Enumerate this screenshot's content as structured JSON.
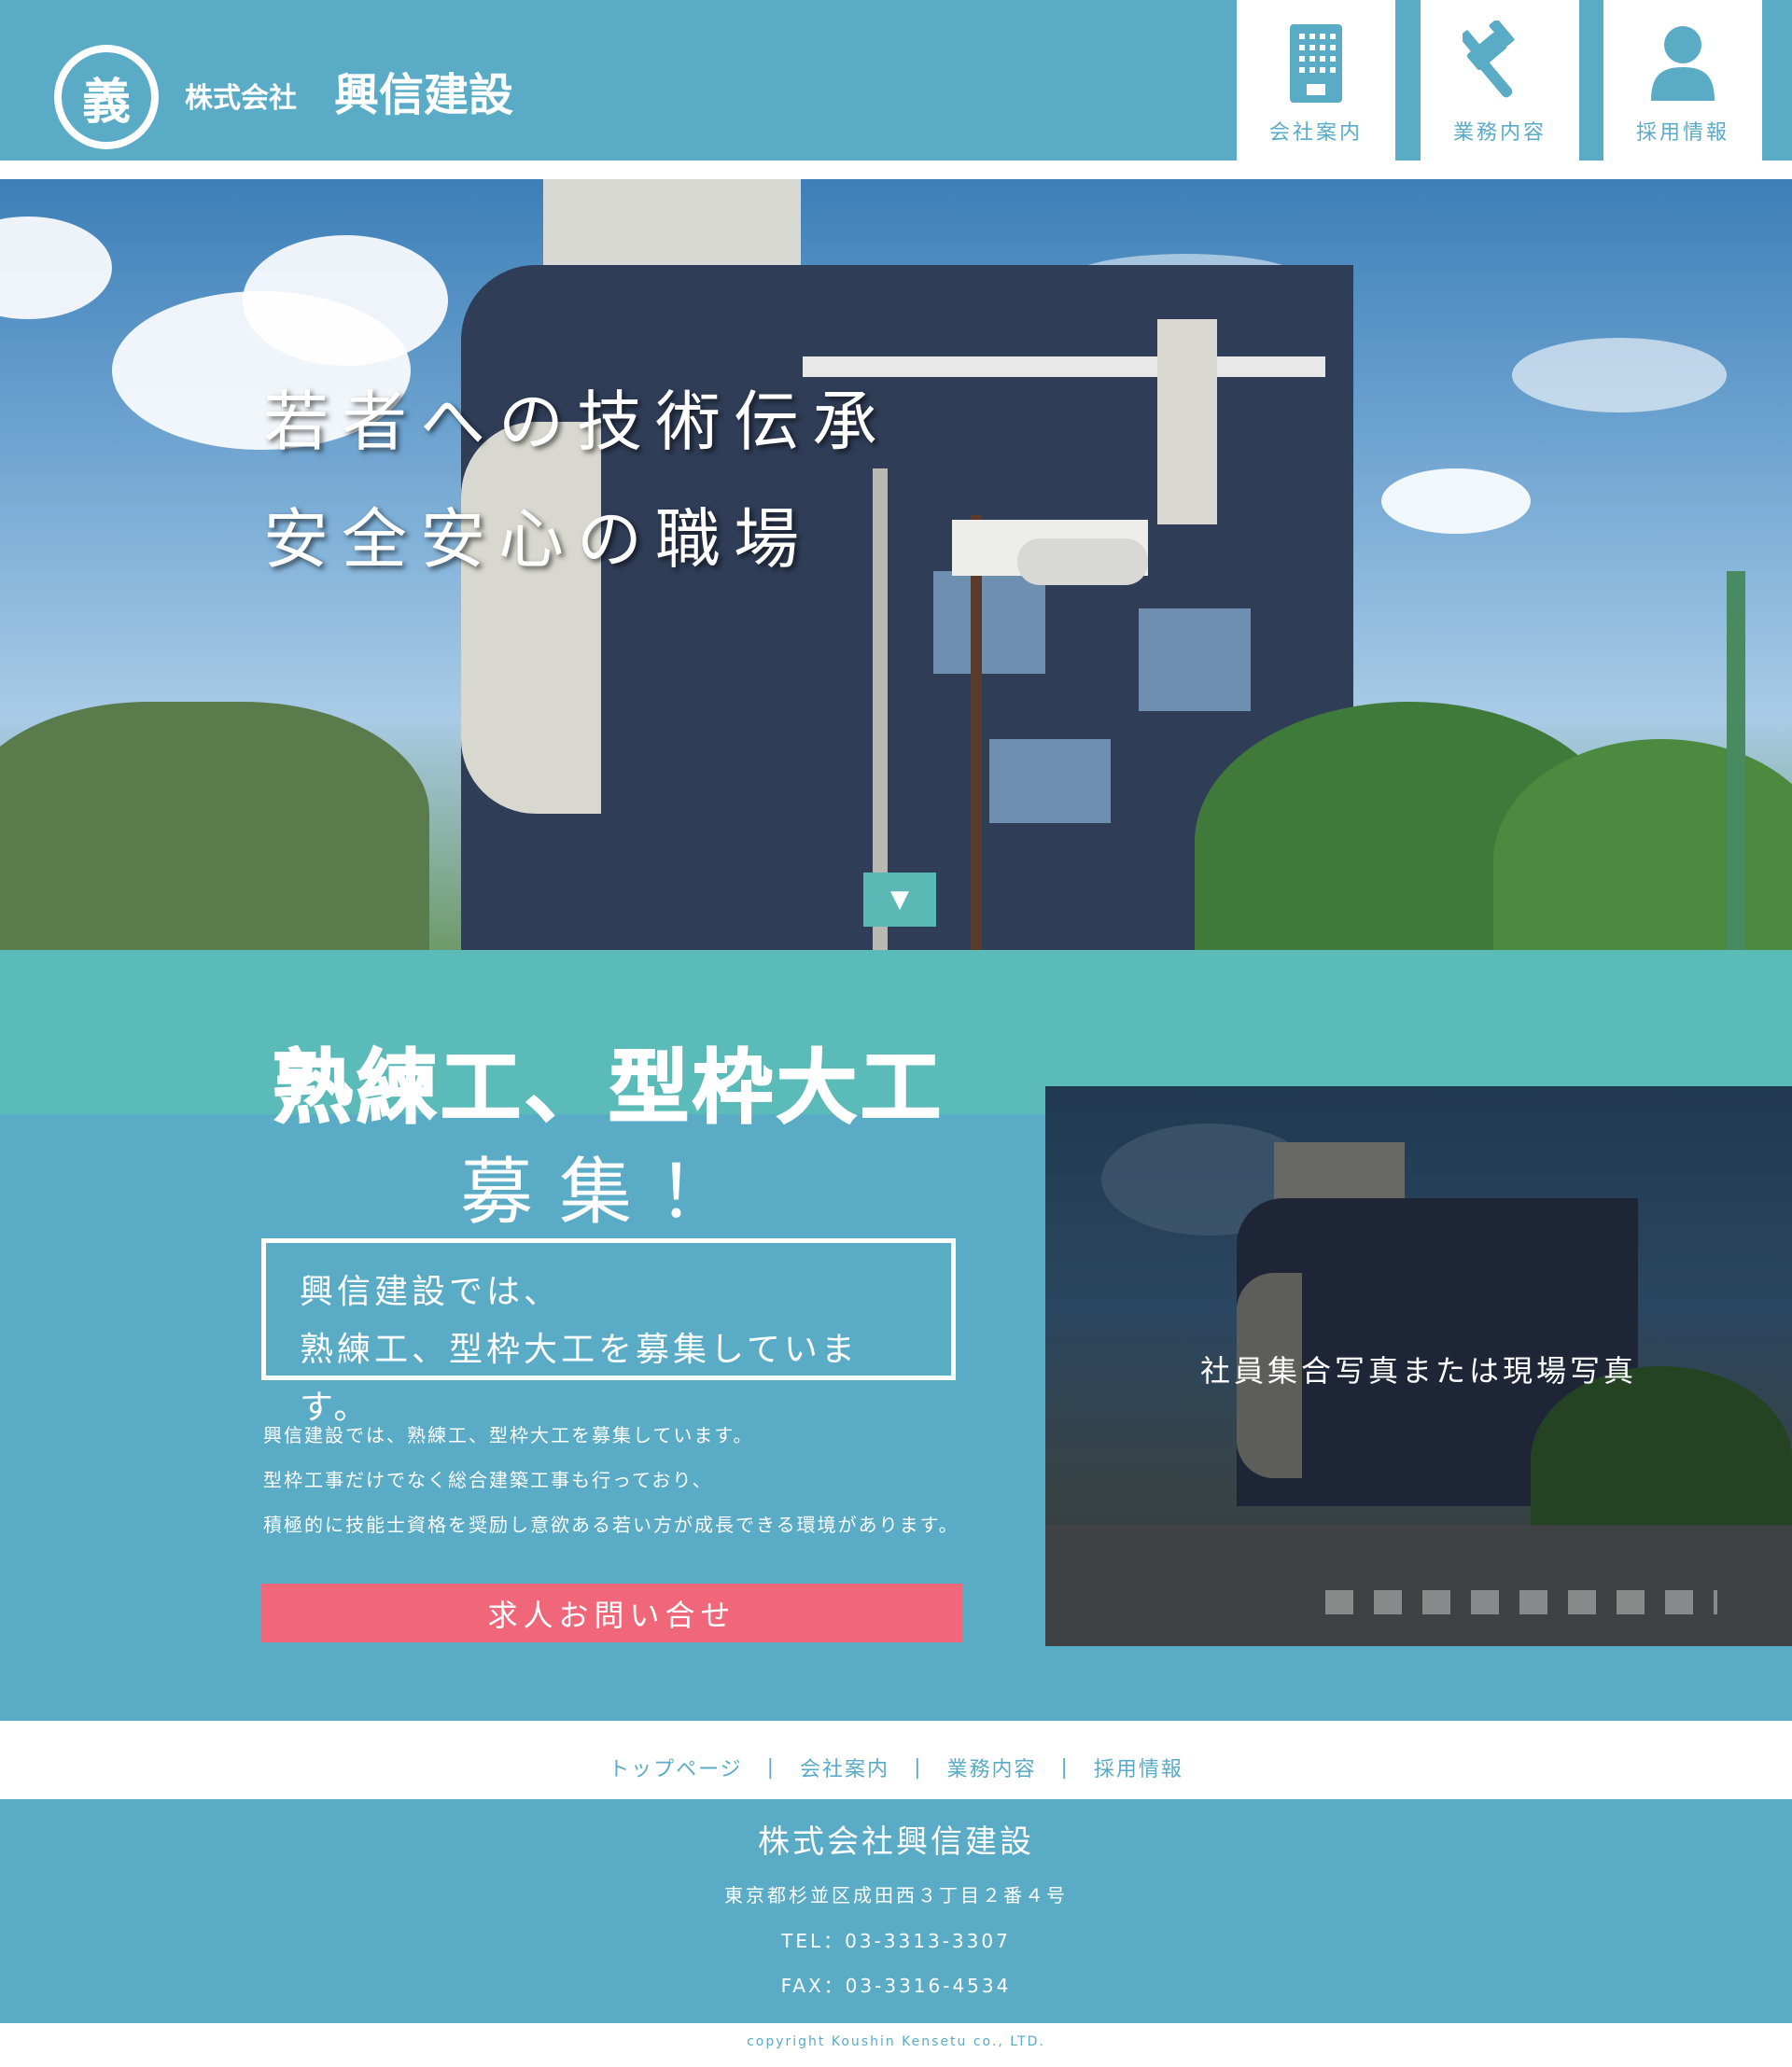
{
  "header": {
    "logo_mark": "義",
    "logo_prefix": "株式会社",
    "logo_name": "興信建設",
    "nav": [
      {
        "label": "会社案内",
        "icon": "building-icon"
      },
      {
        "label": "業務内容",
        "icon": "gavel-icon"
      },
      {
        "label": "採用情報",
        "icon": "person-icon"
      }
    ]
  },
  "hero": {
    "line1": "若者への技術伝承",
    "line2": "安全安心の職場",
    "scroll_icon": "▼"
  },
  "recruit": {
    "headline": "熟練工、型枠大工",
    "headline2": "募集！",
    "boxed_line1": "興信建設では、",
    "boxed_line2": "熟練工、型枠大工を募集しています。",
    "body": [
      "興信建設では、熟練工、型枠大工を募集しています。",
      "型枠工事だけでなく総合建築工事も行っており、",
      "積極的に技能士資格を奨励し意欲ある若い方が成長できる環境があります。"
    ],
    "cta_label": "求人お問い合せ",
    "photo_caption": "社員集合写真または現場写真"
  },
  "footer": {
    "nav": [
      "トップページ",
      "会社案内",
      "業務内容",
      "採用情報"
    ],
    "separator": "|",
    "company": "株式会社興信建設",
    "address": "東京都杉並区成田西３丁目２番４号",
    "tel": "TEL：03-3313-3307",
    "fax": "FAX：03-3316-4534",
    "copyright": "copyright Koushin Kensetu co., LTD."
  },
  "colors": {
    "primary": "#5aabc6",
    "teal": "#5bbbb8",
    "cta": "#f0677a",
    "white": "#ffffff"
  }
}
